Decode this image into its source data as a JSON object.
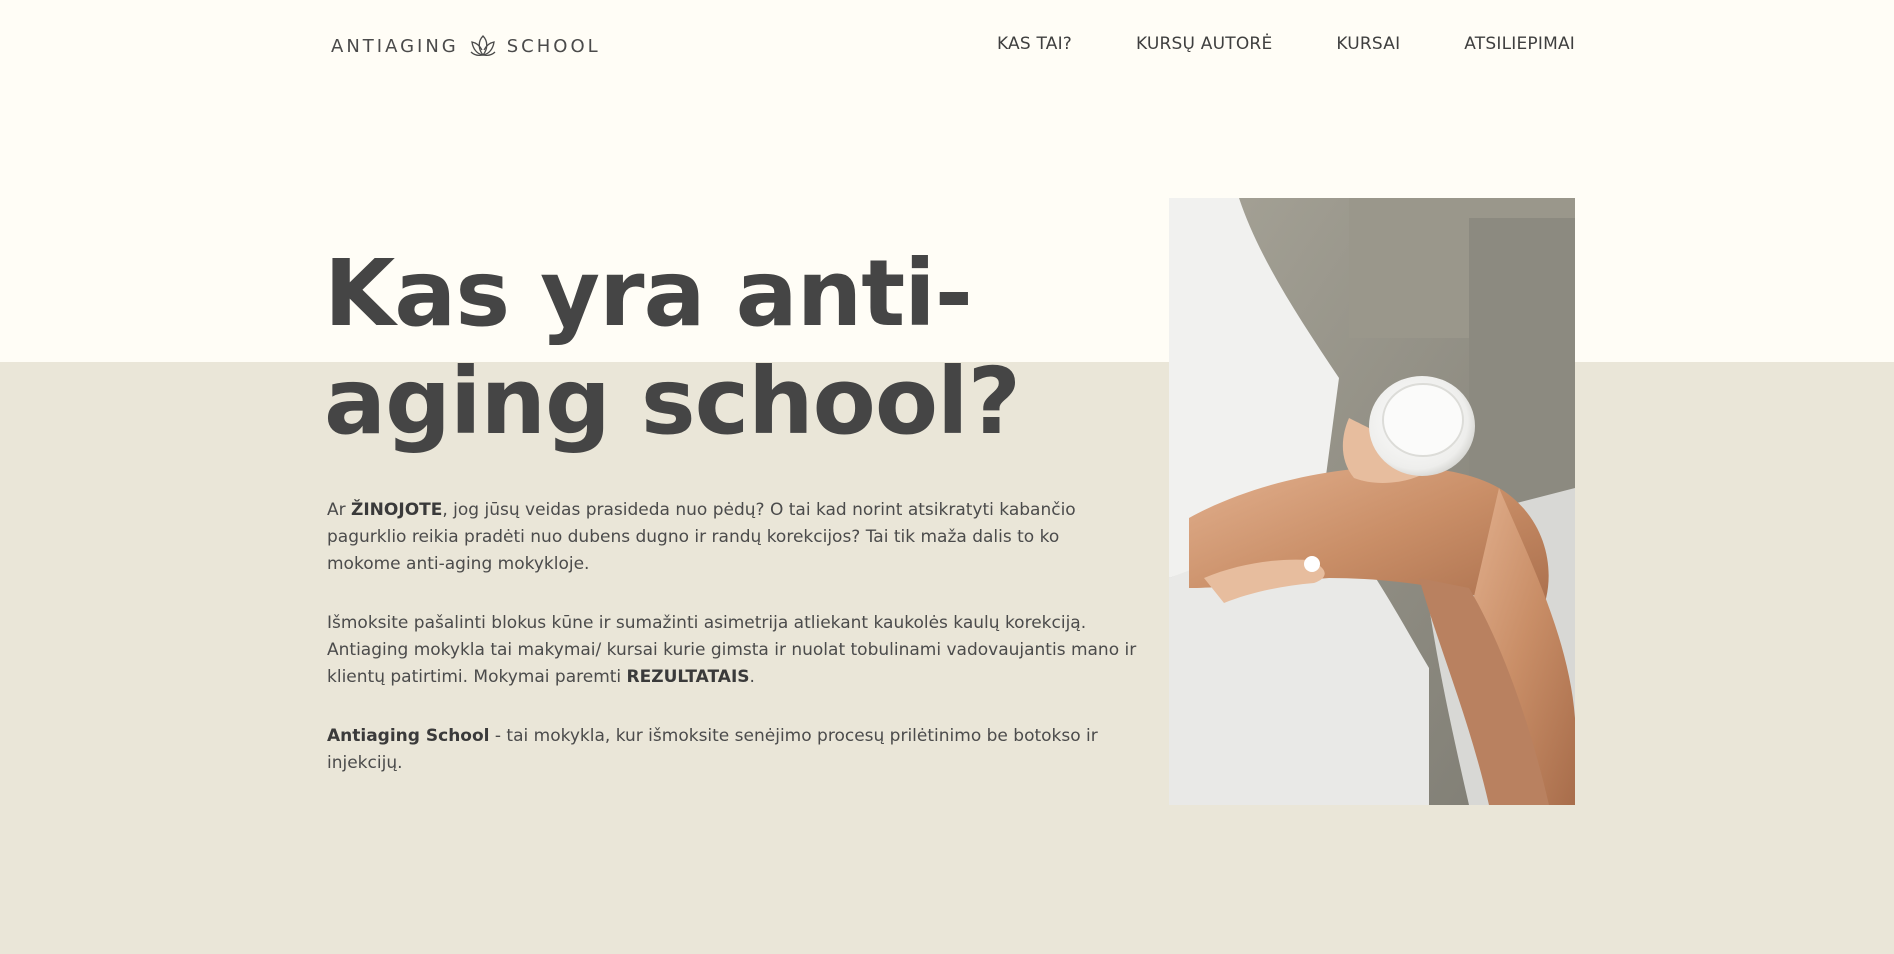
{
  "brand": {
    "left": "ANTIAGING",
    "right": "SCHOOL",
    "icon": "lotus-icon"
  },
  "nav": [
    {
      "label": "KAS TAI?"
    },
    {
      "label": "KURSŲ AUTORĖ"
    },
    {
      "label": "KURSAI"
    },
    {
      "label": "ATSILIEPIMAI"
    }
  ],
  "hero": {
    "title_line1": "Kas yra anti-",
    "title_line2": "aging school?",
    "p1": {
      "pre": "Ar ",
      "bold": "ŽINOJOTE",
      "post": ", jog jūsų veidas prasideda nuo pėdų? O tai kad norint atsikratyti kabančio pagurklio reikia pradėti nuo dubens dugno ir randų korekcijos? Tai tik maža dalis to ko mokome anti-aging mokykloje."
    },
    "p2": {
      "pre": "Išmoksite pašalinti blokus kūne ir sumažinti asimetrija atliekant kaukolės kaulų korekciją. Antiaging mokykla tai makymai/ kursai kurie gimsta ir nuolat tobulinami vadovaujantis mano ir klientų patirtimi. Mokymai paremti ",
      "bold": "REZULTATAIS",
      "post": "."
    },
    "p3": {
      "bold": "Antiaging School",
      "post": " - tai mokykla, kur išmoksite senėjimo procesų prilėtinimo be botokso ir injekcijų."
    }
  },
  "colors": {
    "top_bg": "#fffdf6",
    "bottom_bg": "#eae6d8",
    "text": "#454545"
  }
}
